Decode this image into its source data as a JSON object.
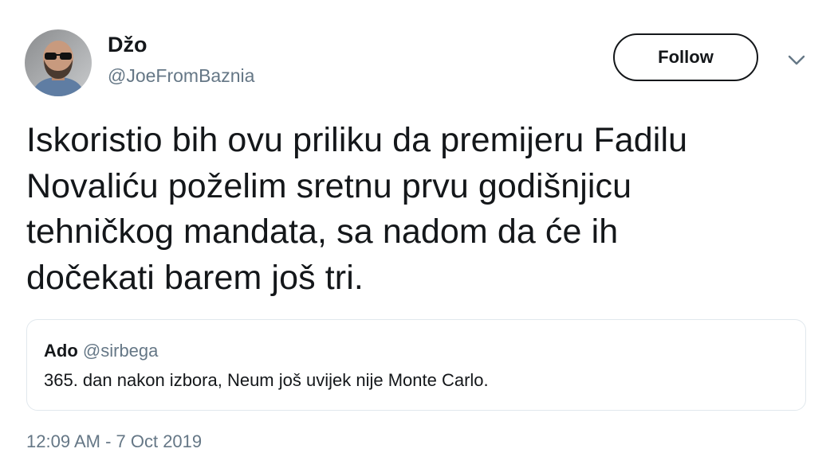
{
  "author": {
    "display_name": "Džo",
    "handle": "@JoeFromBaznia",
    "avatar_icon": "user-avatar-photo"
  },
  "actions": {
    "follow_label": "Follow",
    "menu_icon": "chevron-down-icon"
  },
  "tweet": {
    "lines": [
      "Iskoristio bih ovu priliku da premijeru Fadilu",
      "Novaliću poželim sretnu prvu godišnjicu",
      "tehničkog mandata, sa nadom da će ih",
      "dočekati barem još tri."
    ],
    "timestamp": "12:09 AM - 7 Oct 2019"
  },
  "quoted_tweet": {
    "display_name": "Ado",
    "handle": "@sirbega",
    "text": "365. dan nakon izbora, Neum još uvijek nije Monte Carlo."
  },
  "colors": {
    "primary_text": "#14171a",
    "secondary_text": "#657786",
    "border": "#e1e8ed"
  }
}
